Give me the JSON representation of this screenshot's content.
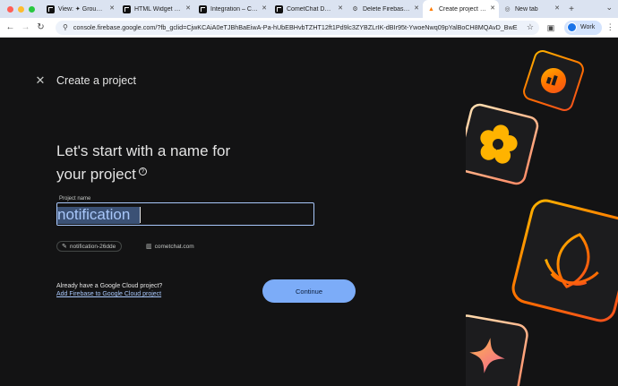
{
  "browser": {
    "tabs": [
      {
        "label": "View: ✦ Group Ch...",
        "icon": "cometchat-icon",
        "active": false
      },
      {
        "label": "HTML Widget Buil...",
        "icon": "cometchat-icon",
        "active": false
      },
      {
        "label": "Integration – Con...",
        "icon": "cometchat-icon",
        "active": false
      },
      {
        "label": "CometChat Dashb...",
        "icon": "cometchat-icon",
        "active": false
      },
      {
        "label": "Delete Firebase p...",
        "icon": "gear-icon",
        "active": false
      },
      {
        "label": "Create project – F...",
        "icon": "firebase-icon",
        "active": true
      },
      {
        "label": "New tab",
        "icon": "globe-icon",
        "active": false
      }
    ],
    "url": "console.firebase.google.com/?fb_gclid=CjwKCAiA0eTJBhBaEiwA-Pa-hUbEBHvbTZHT12ft1Pd9lc3ZYBZLrIK-dBIr95t-YwoeNwq09pYalBoCH8MQAvD_BwE",
    "profile_label": "Work"
  },
  "page": {
    "title": "Create a project",
    "heading_line1": "Let's start with a name for",
    "heading_line2": "your project",
    "field_label": "Project name",
    "field_value": "notification",
    "project_id_chip": "notification-26dde",
    "domain_chip": "cometchat.com",
    "cloud_question": "Already have a Google Cloud project?",
    "cloud_link": "Add Firebase to Google Cloud project",
    "continue_label": "Continue"
  },
  "colors": {
    "page_bg": "#131314",
    "accent": "#7cacf8",
    "tab_strip": "#dbe3f1"
  }
}
